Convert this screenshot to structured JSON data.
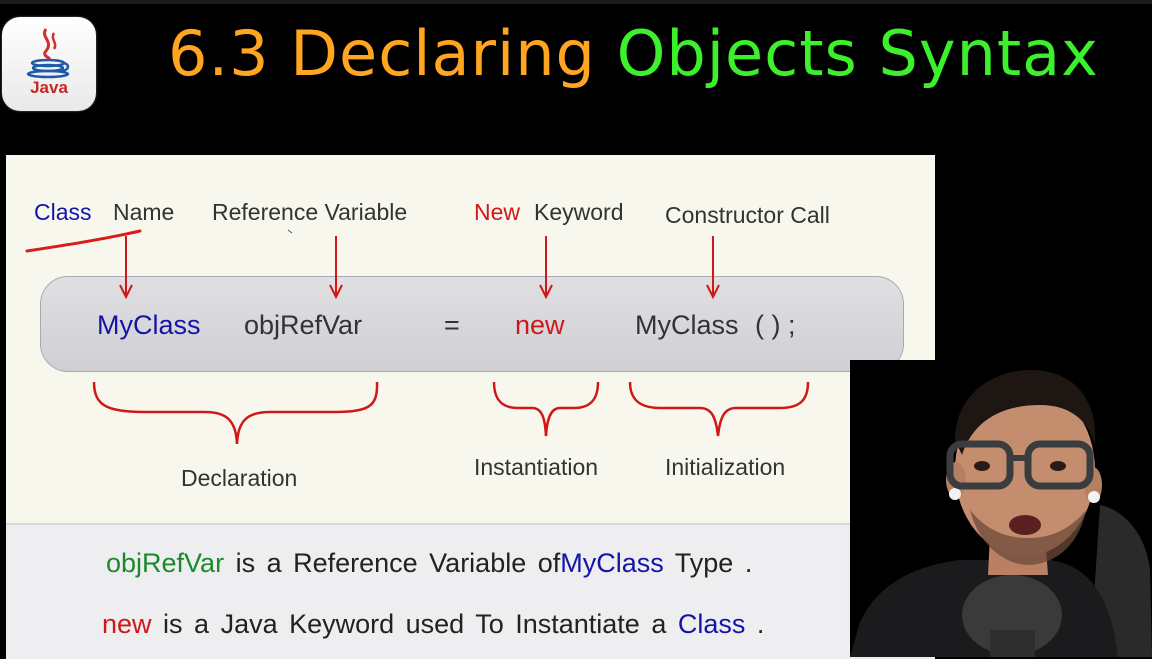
{
  "logo": {
    "text": "Java"
  },
  "title": {
    "part1": "6.3 Declaring",
    "part2": "Objects Syntax"
  },
  "labels": {
    "class_word": "Class",
    "name_word": "Name",
    "reference_variable": "Reference Variable",
    "new_word": "New",
    "keyword_word": "Keyword",
    "constructor_call": "Constructor Call"
  },
  "code": {
    "class_name": "MyClass",
    "ref_var": "objRefVar",
    "equals": "=",
    "new_kw": "new",
    "constructor": "MyClass",
    "parens": "( ) ;"
  },
  "groups": {
    "declaration": "Declaration",
    "instantiation": "Instantiation",
    "initialization": "Initialization"
  },
  "sentence1": {
    "var": "objRefVar",
    "mid": "is a Reference Variable of",
    "cls": "MyClass",
    "end": "Type ."
  },
  "sentence2": {
    "kw": "new",
    "mid": "is a Java Keyword used To Instantiate a",
    "cls": "Class",
    "end": "."
  },
  "colors": {
    "title_orange": "#ffa51f",
    "title_green": "#3cf02c",
    "keyword_blue": "#1414a8",
    "keyword_red": "#d01818",
    "var_green": "#1c8a2c",
    "arrow_red": "#d01818"
  }
}
